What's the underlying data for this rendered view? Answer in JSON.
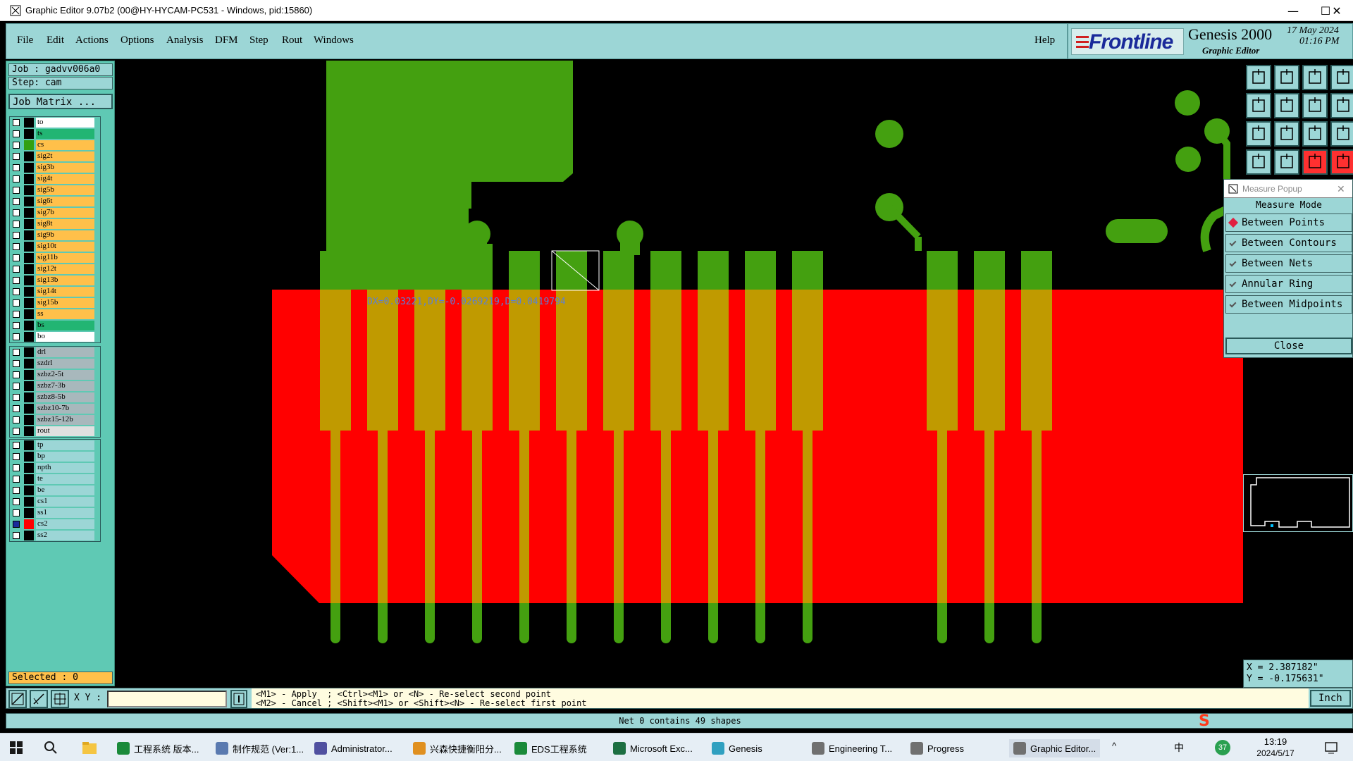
{
  "window": {
    "title": "Graphic Editor 9.07b2 (00@HY-HYCAM-PC531 - Windows, pid:15860)",
    "minimize": "—",
    "maximize": "☐",
    "close": "✕"
  },
  "menu": {
    "items": [
      "File",
      "Edit",
      "Actions",
      "Options",
      "Analysis",
      "DFM",
      "Step",
      "Rout",
      "Windows"
    ],
    "help": "Help"
  },
  "brand": {
    "logo": "Frontline",
    "product": "Genesis 2000",
    "subtitle": "Graphic Editor",
    "date": "17 May 2024",
    "time": "01:16 PM"
  },
  "job": {
    "job_label": "Job : gadvv006a0",
    "step_label": "Step: cam",
    "matrix_button": "Job Matrix ..."
  },
  "layers": {
    "group1": [
      {
        "name": "to",
        "color": "#ffffff",
        "sw": "#000000"
      },
      {
        "name": "ts",
        "color": "#22b573",
        "sw": "#000000"
      },
      {
        "name": "cs",
        "color": "#ffc04a",
        "sw": "#32a010"
      },
      {
        "name": "sig2t",
        "color": "#ffc04a",
        "sw": "#000000"
      },
      {
        "name": "sig3b",
        "color": "#ffc04a",
        "sw": "#000000"
      },
      {
        "name": "sig4t",
        "color": "#ffc04a",
        "sw": "#000000"
      },
      {
        "name": "sig5b",
        "color": "#ffc04a",
        "sw": "#000000"
      },
      {
        "name": "sig6t",
        "color": "#ffc04a",
        "sw": "#000000"
      },
      {
        "name": "sig7b",
        "color": "#ffc04a",
        "sw": "#000000"
      },
      {
        "name": "sig8t",
        "color": "#ffc04a",
        "sw": "#000000"
      },
      {
        "name": "sig9b",
        "color": "#ffc04a",
        "sw": "#000000"
      },
      {
        "name": "sig10t",
        "color": "#ffc04a",
        "sw": "#000000"
      },
      {
        "name": "sig11b",
        "color": "#ffc04a",
        "sw": "#000000"
      },
      {
        "name": "sig12t",
        "color": "#ffc04a",
        "sw": "#000000"
      },
      {
        "name": "sig13b",
        "color": "#ffc04a",
        "sw": "#000000"
      },
      {
        "name": "sig14t",
        "color": "#ffc04a",
        "sw": "#000000"
      },
      {
        "name": "sig15b",
        "color": "#ffc04a",
        "sw": "#000000"
      },
      {
        "name": "ss",
        "color": "#ffc04a",
        "sw": "#000000"
      },
      {
        "name": "bs",
        "color": "#22b573",
        "sw": "#000000"
      },
      {
        "name": "bo",
        "color": "#ffffff",
        "sw": "#000000"
      }
    ],
    "group2": [
      {
        "name": "drl",
        "color": "#a8b8bc",
        "sw": "#000000"
      },
      {
        "name": "szdrl",
        "color": "#a8b8bc",
        "sw": "#000000"
      },
      {
        "name": "szbz2-5t",
        "color": "#a8b8bc",
        "sw": "#000000"
      },
      {
        "name": "szbz7-3b",
        "color": "#a8b8bc",
        "sw": "#000000"
      },
      {
        "name": "szbz8-5b",
        "color": "#a8b8bc",
        "sw": "#000000"
      },
      {
        "name": "szbz10-7b",
        "color": "#a8b8bc",
        "sw": "#000000"
      },
      {
        "name": "szbz15-12b",
        "color": "#a8b8bc",
        "sw": "#000000"
      },
      {
        "name": "rout",
        "color": "#e0e0e0",
        "sw": "#000000"
      }
    ],
    "group3": [
      {
        "name": "tp",
        "color": "#9cd6d6",
        "sw": "#000000"
      },
      {
        "name": "bp",
        "color": "#9cd6d6",
        "sw": "#000000"
      },
      {
        "name": "npth",
        "color": "#9cd6d6",
        "sw": "#000000"
      },
      {
        "name": "te",
        "color": "#9cd6d6",
        "sw": "#000000"
      },
      {
        "name": "be",
        "color": "#9cd6d6",
        "sw": "#000000"
      },
      {
        "name": "cs1",
        "color": "#9cd6d6",
        "sw": "#000000"
      },
      {
        "name": "ss1",
        "color": "#9cd6d6",
        "sw": "#000000"
      },
      {
        "name": "cs2",
        "color": "#9cd6d6",
        "sw": "#ff0000"
      },
      {
        "name": "ss2",
        "color": "#9cd6d6",
        "sw": "#000000"
      }
    ]
  },
  "selected": "Selected : 0",
  "measure": {
    "readout": "DX=0.03221,DY=-0.0269219,D=0.0419794"
  },
  "popup": {
    "title": "Measure Popup",
    "mode_label": "Measure Mode",
    "options": [
      "Between Points",
      "Between Contours",
      "Between Nets",
      "Annular Ring",
      "Between Midpoints"
    ],
    "selected_index": 0,
    "close_button": "Close"
  },
  "coords": {
    "x": "X = 2.387182\"",
    "y": "Y = -0.175631\""
  },
  "bottom": {
    "xy_label": "X Y :",
    "xy_value": "",
    "hint_line1": "<M1> - Apply  ; <Ctrl><M1> or <N> - Re-select second point",
    "hint_line2": "<M2> - Cancel ; <Shift><M1> or <Shift><N> - Re-select first point",
    "units": "Inch"
  },
  "status": "Net 0 contains 49 shapes",
  "taskbar": {
    "items": [
      {
        "label": "工程系统  版本...",
        "color": "#1a8a3a"
      },
      {
        "label": "制作规范 (Ver:1...",
        "color": "#5a7ab0"
      },
      {
        "label": "Administrator...",
        "color": "#5050a0"
      },
      {
        "label": "兴森快捷衡阳分...",
        "color": "#e09020"
      },
      {
        "label": "EDS工程系统",
        "color": "#1a8a3a"
      },
      {
        "label": "Microsoft Exc...",
        "color": "#1d6f42"
      },
      {
        "label": "Genesis",
        "color": "#30a0c0"
      },
      {
        "label": "Engineering T...",
        "color": "#707070"
      },
      {
        "label": "Progress",
        "color": "#707070"
      },
      {
        "label": "Graphic Editor...",
        "color": "#707070"
      }
    ],
    "lang": "中",
    "badge": "37",
    "time": "13:19",
    "date": "2024/5/17"
  }
}
